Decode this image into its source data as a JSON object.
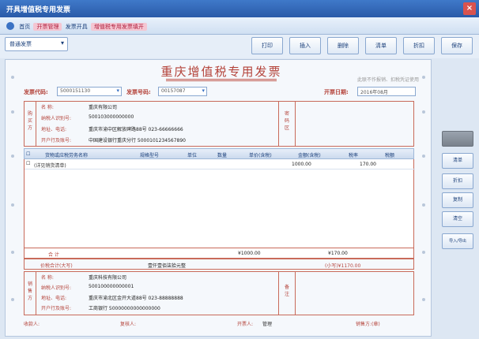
{
  "window": {
    "title": "开具增值税专用发票",
    "close": "×"
  },
  "crumbs": {
    "home": "首页",
    "path1": "开票管理",
    "path2": "发票开具",
    "path3": "增值税专用发票填开"
  },
  "toolbar": {
    "select_value": "普通发票",
    "buttons": [
      "打印",
      "插入",
      "删除",
      "清单",
      "折扣",
      "保存"
    ]
  },
  "invoice": {
    "title": "重庆增值税专用发票",
    "side_note": "此联不作报销、扣税凭证使用",
    "code_label": "发票代码:",
    "code_value": "5000151130",
    "number_label": "发票号码:",
    "number_value": "00157087",
    "date_label": "开票日期:",
    "date_value": "2016年08月",
    "buyer_vlabel": "购买方",
    "buyer": {
      "name_k": "名    称:",
      "name_v": "重庆有限公司",
      "tax_k": "纳税人识别号:",
      "tax_v": "500103000000000",
      "addr_k": "地址、电话:",
      "addr_v": "重庆市渝中区解放碑路88号 023-66666666",
      "bank_k": "开户行及账号:",
      "bank_v": "中国建设银行重庆分行 5000101234567890"
    },
    "code_area_label": "密码区",
    "columns": [
      "货物或应税劳务名称",
      "规格型号",
      "单位",
      "数量",
      "单价(含税)",
      "金额(含税)",
      "税率",
      "税额"
    ],
    "row1": {
      "name": "(详见销货清单)",
      "amount": "1000.00",
      "tax": "170.00"
    },
    "total_label": "合    计",
    "total_amount": "¥1000.00",
    "total_tax": "¥170.00",
    "grand_label": "价税合计(大写)",
    "grand_words": "壹仟壹佰柒拾元整",
    "grand_small": "(小写)¥1170.00",
    "seller_vlabel": "销售方",
    "seller": {
      "name_k": "名    称:",
      "name_v": "重庆科技有限公司",
      "tax_k": "纳税人识别号:",
      "tax_v": "500100000000001",
      "addr_k": "地址、电话:",
      "addr_v": "重庆市渝北区金开大道88号 023-88888888",
      "bank_k": "开户行及账号:",
      "bank_v": "工商银行 50000000000000000"
    },
    "remark_label": "备注",
    "payee_label": "收款人:",
    "reviewer_label": "复核人:",
    "drawer_label": "开票人:",
    "drawer_value": "管理",
    "seller_seal_label": "销售方:(章)"
  },
  "right_buttons": [
    "清单",
    "折扣",
    "复制",
    "清空",
    "导入/导出"
  ]
}
